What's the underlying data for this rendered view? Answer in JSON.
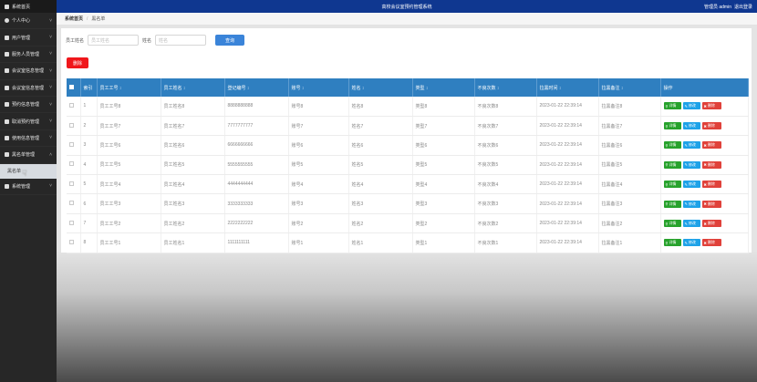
{
  "app": {
    "title": "高校会议室预约管理系统",
    "user_label": "管理员 admin",
    "logout": "退出登录"
  },
  "sidebar": {
    "home": "系统首页",
    "items": [
      {
        "label": "个人中心",
        "icon": "user-icon"
      },
      {
        "label": "用户管理",
        "icon": "user-group-icon"
      },
      {
        "label": "服务人员管理",
        "icon": "staff-icon"
      },
      {
        "label": "会议室信息管理",
        "icon": "room-icon"
      },
      {
        "label": "会议室信息管理",
        "icon": "grid-icon"
      },
      {
        "label": "预约信息管理",
        "icon": "calendar-icon"
      },
      {
        "label": "取消预约管理",
        "icon": "cancel-icon"
      },
      {
        "label": "使用信息管理",
        "icon": "info-icon"
      },
      {
        "label": "黑名单管理",
        "icon": "blacklist-icon"
      }
    ],
    "subitem": "黑名单",
    "last_item": "系统管理"
  },
  "breadcrumb": {
    "home": "系统首页",
    "current": "黑名单"
  },
  "search": {
    "field1_label": "员工姓名",
    "field1_placeholder": "员工姓名",
    "field2_label": "姓名",
    "field2_placeholder": "姓名",
    "button": "查询"
  },
  "delete_button": "删除",
  "table": {
    "columns": [
      "",
      "索引",
      "员工工号",
      "员工姓名",
      "登记编号",
      "账号",
      "姓名",
      "类型",
      "不良次数",
      "拉黑时间",
      "拉黑备注",
      "操作"
    ],
    "sortable": [
      false,
      false,
      true,
      true,
      true,
      true,
      true,
      true,
      true,
      true,
      true,
      false
    ],
    "rows": [
      [
        "1",
        "员工工号8",
        "员工姓名8",
        "8888888888",
        "账号8",
        "姓名8",
        "类型8",
        "不良次数8",
        "2023-01-22 22:39:14",
        "拉黑备注8"
      ],
      [
        "2",
        "员工工号7",
        "员工姓名7",
        "7777777777",
        "账号7",
        "姓名7",
        "类型7",
        "不良次数7",
        "2023-01-22 22:39:14",
        "拉黑备注7"
      ],
      [
        "3",
        "员工工号6",
        "员工姓名6",
        "6666666666",
        "账号6",
        "姓名6",
        "类型6",
        "不良次数6",
        "2023-01-22 22:39:14",
        "拉黑备注6"
      ],
      [
        "4",
        "员工工号5",
        "员工姓名5",
        "5555555555",
        "账号5",
        "姓名5",
        "类型5",
        "不良次数5",
        "2023-01-22 22:39:14",
        "拉黑备注5"
      ],
      [
        "5",
        "员工工号4",
        "员工姓名4",
        "4444444444",
        "账号4",
        "姓名4",
        "类型4",
        "不良次数4",
        "2023-01-22 22:39:14",
        "拉黑备注4"
      ],
      [
        "6",
        "员工工号3",
        "员工姓名3",
        "3333333333",
        "账号3",
        "姓名3",
        "类型3",
        "不良次数3",
        "2023-01-22 22:39:14",
        "拉黑备注3"
      ],
      [
        "7",
        "员工工号2",
        "员工姓名2",
        "2222222222",
        "账号2",
        "姓名2",
        "类型2",
        "不良次数2",
        "2023-01-22 22:39:14",
        "拉黑备注2"
      ],
      [
        "8",
        "员工工号1",
        "员工姓名1",
        "1111111111",
        "账号1",
        "姓名1",
        "类型1",
        "不良次数1",
        "2023-01-22 22:39:14",
        "拉黑备注1"
      ]
    ],
    "actions": {
      "view": "详情",
      "edit": "修改",
      "delete": "删除"
    }
  },
  "colors": {
    "topbar": "#0f3790",
    "sidebar": "#272727",
    "table_header": "#2f7fc0",
    "search_button": "#3a84d9",
    "delete_button": "#f0171b",
    "view_button": "#27a22c",
    "edit_button": "#1ea2e8",
    "row_delete_button": "#e0413a"
  }
}
